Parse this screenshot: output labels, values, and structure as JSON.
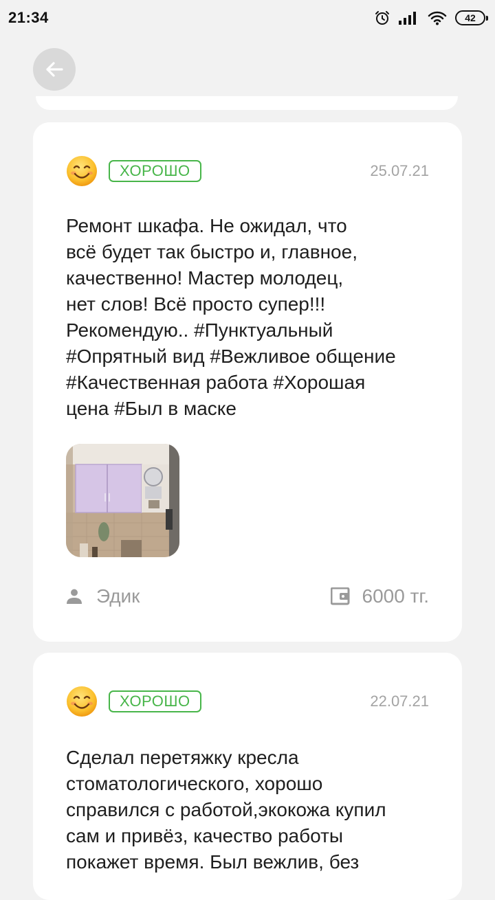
{
  "status_bar": {
    "time": "21:34",
    "battery": "42",
    "icons": [
      "alarm-icon",
      "signal-icon",
      "wifi-icon",
      "battery-icon"
    ]
  },
  "navigation": {
    "back_icon": "arrow-left-icon"
  },
  "colors": {
    "background": "#f2f2f2",
    "card": "#ffffff",
    "accent_green": "#47b549",
    "muted_text": "#a3a3a3"
  },
  "reviews": [
    {
      "emoji": "smiling-face-icon",
      "rating": "ХОРОШО",
      "date": "25.07.21",
      "text": "Ремонт шкафа. Не ожидал, что\nвсё будет так быстро и, главное,\nкачественно! Мастер молодец,\nнет слов! Всё просто супер!!!\nРекомендую..  #Пунктуальный\n#Опрятный вид #Вежливое общение\n#Качественная работа #Хорошая\nцена #Был в маске",
      "author": "Эдик",
      "price": "6000 тг."
    },
    {
      "emoji": "smiling-face-icon",
      "rating": "ХОРОШО",
      "date": "22.07.21",
      "text": "Сделал перетяжку кресла\nстоматологического, хорошо\nсправился с работой,экокожа купил\nсам и привёз,  качество работы\nпокажет время. Был вежлив, без"
    }
  ]
}
